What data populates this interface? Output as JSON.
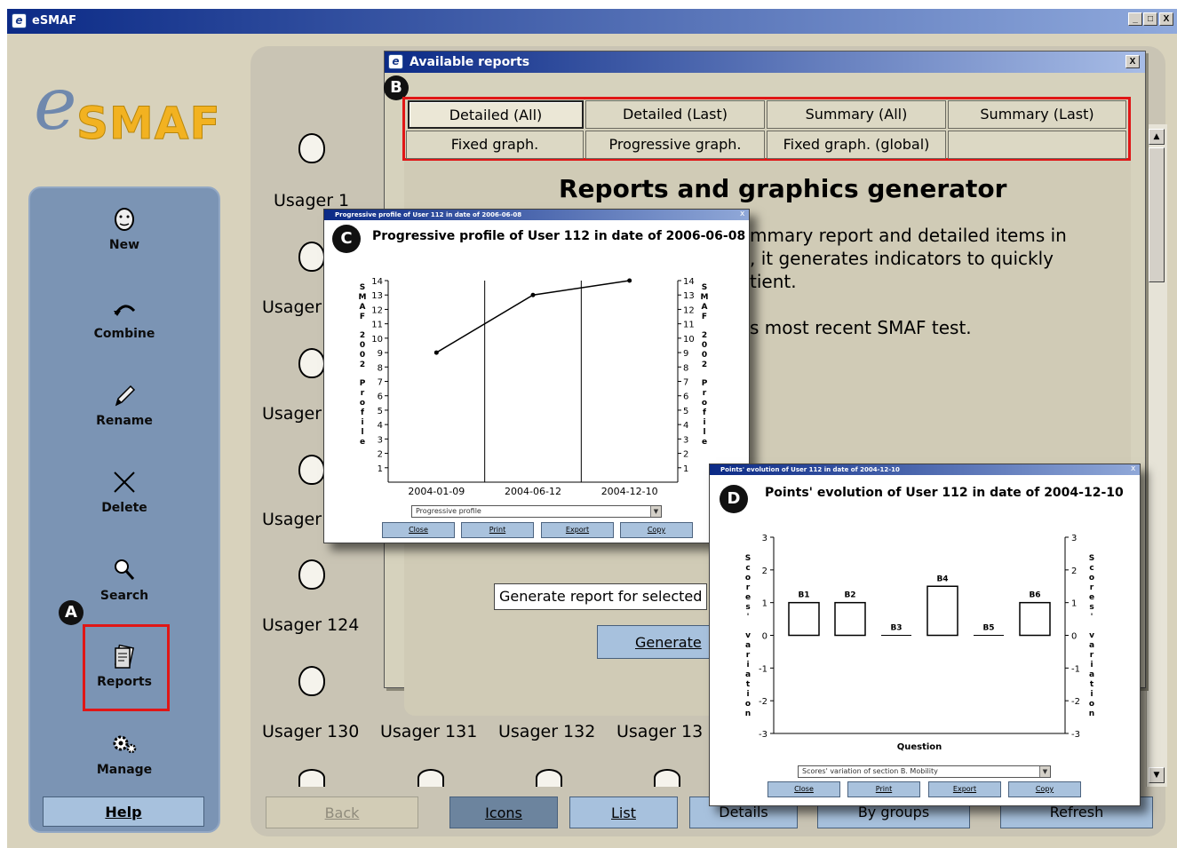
{
  "app": {
    "title": "eSMAF",
    "icon": "e-logo-icon"
  },
  "window_controls": {
    "minimize": "_",
    "maximize": "□",
    "close": "X"
  },
  "logo": {
    "e": "e",
    "text": "SMAF"
  },
  "sidebar": {
    "items": [
      {
        "label": "New",
        "icon": "face-icon"
      },
      {
        "label": "Combine",
        "icon": "combine-arrow-icon"
      },
      {
        "label": "Rename",
        "icon": "pencil-icon"
      },
      {
        "label": "Delete",
        "icon": "x-icon"
      },
      {
        "label": "Search",
        "icon": "magnifier-icon"
      },
      {
        "label": "Reports",
        "icon": "reports-icon"
      },
      {
        "label": "Manage",
        "icon": "gears-icon"
      }
    ],
    "help": "Help"
  },
  "users": [
    {
      "label": "Usager 1"
    },
    {
      "label": "Usager"
    },
    {
      "label": "Usager"
    },
    {
      "label": "Usager"
    },
    {
      "label": "Usager 124"
    },
    {
      "label": "Usager 130"
    },
    {
      "label": "Usager 131"
    },
    {
      "label": "Usager 132"
    },
    {
      "label": "Usager 13"
    }
  ],
  "bottom_bar": {
    "back": "Back",
    "icons": "Icons",
    "list": "List",
    "details": "Details",
    "by_groups": "By groups",
    "refresh": "Refresh"
  },
  "markers": {
    "a": "A",
    "b": "B",
    "c": "C",
    "d": "D"
  },
  "reports_dialog": {
    "title": "Available reports",
    "close": "X",
    "tabs": [
      {
        "label": "Detailed (All)",
        "selected": true
      },
      {
        "label": "Detailed (Last)",
        "selected": false
      },
      {
        "label": "Summary (All)",
        "selected": false
      },
      {
        "label": "Summary (Last)",
        "selected": false
      },
      {
        "label": "Fixed graph.",
        "selected": false
      },
      {
        "label": "Progressive graph.",
        "selected": false
      },
      {
        "label": "Fixed graph. (global)",
        "selected": false
      },
      {
        "label": "",
        "selected": false
      }
    ],
    "heading": "Reports and graphics generator",
    "desc_line1": "mmary report and detailed items in",
    "desc_line2": ", it generates indicators to quickly",
    "desc_line3": "tient.",
    "desc_line4": "s most recent SMAF test.",
    "select_value": "Generate report for selected p",
    "generate_button": "Generate"
  },
  "progressive_popup": {
    "window_title": "Progressive profile of User 112 in date of 2006-06-08",
    "close": "x",
    "heading": "Progressive profile of User 112 in date of 2006-06-08",
    "select_value": "Progressive profile",
    "buttons": {
      "close": "Close",
      "print": "Print",
      "export": "Export",
      "copy": "Copy"
    }
  },
  "points_popup": {
    "window_title": "Points' evolution of User 112 in date of 2004-12-10",
    "close": "x",
    "heading": "Points' evolution of User 112 in date of 2004-12-10",
    "select_value": "Scores' variation of section B. Mobility",
    "buttons": {
      "close": "Close",
      "print": "Print",
      "export": "Export",
      "copy": "Copy"
    }
  },
  "chart_data": [
    {
      "type": "line",
      "title": "Progressive profile of User 112 in date of 2006-06-08",
      "ylabel": "SMAF 2002 Profile",
      "ylabel_right": "SMAF 2002 Profile",
      "x": [
        "2004-01-09",
        "2004-06-12",
        "2004-12-10"
      ],
      "values": [
        9,
        13,
        14
      ],
      "ylim": [
        1,
        14
      ],
      "yticks": [
        1,
        2,
        3,
        4,
        5,
        6,
        7,
        8,
        9,
        10,
        11,
        12,
        13,
        14
      ],
      "grid": "vertical"
    },
    {
      "type": "bar",
      "title": "Points' evolution of User 112 in date of 2004-12-10",
      "xlabel": "Question",
      "ylabel": "Scores' variation",
      "ylabel_right": "Scores' variation",
      "categories": [
        "B1",
        "B2",
        "B3",
        "B4",
        "B5",
        "B6"
      ],
      "values": [
        1,
        1,
        0,
        1.5,
        0,
        1
      ],
      "ylim": [
        -3,
        3
      ],
      "yticks": [
        -3,
        -2,
        -1,
        0,
        1,
        2,
        3
      ]
    }
  ]
}
